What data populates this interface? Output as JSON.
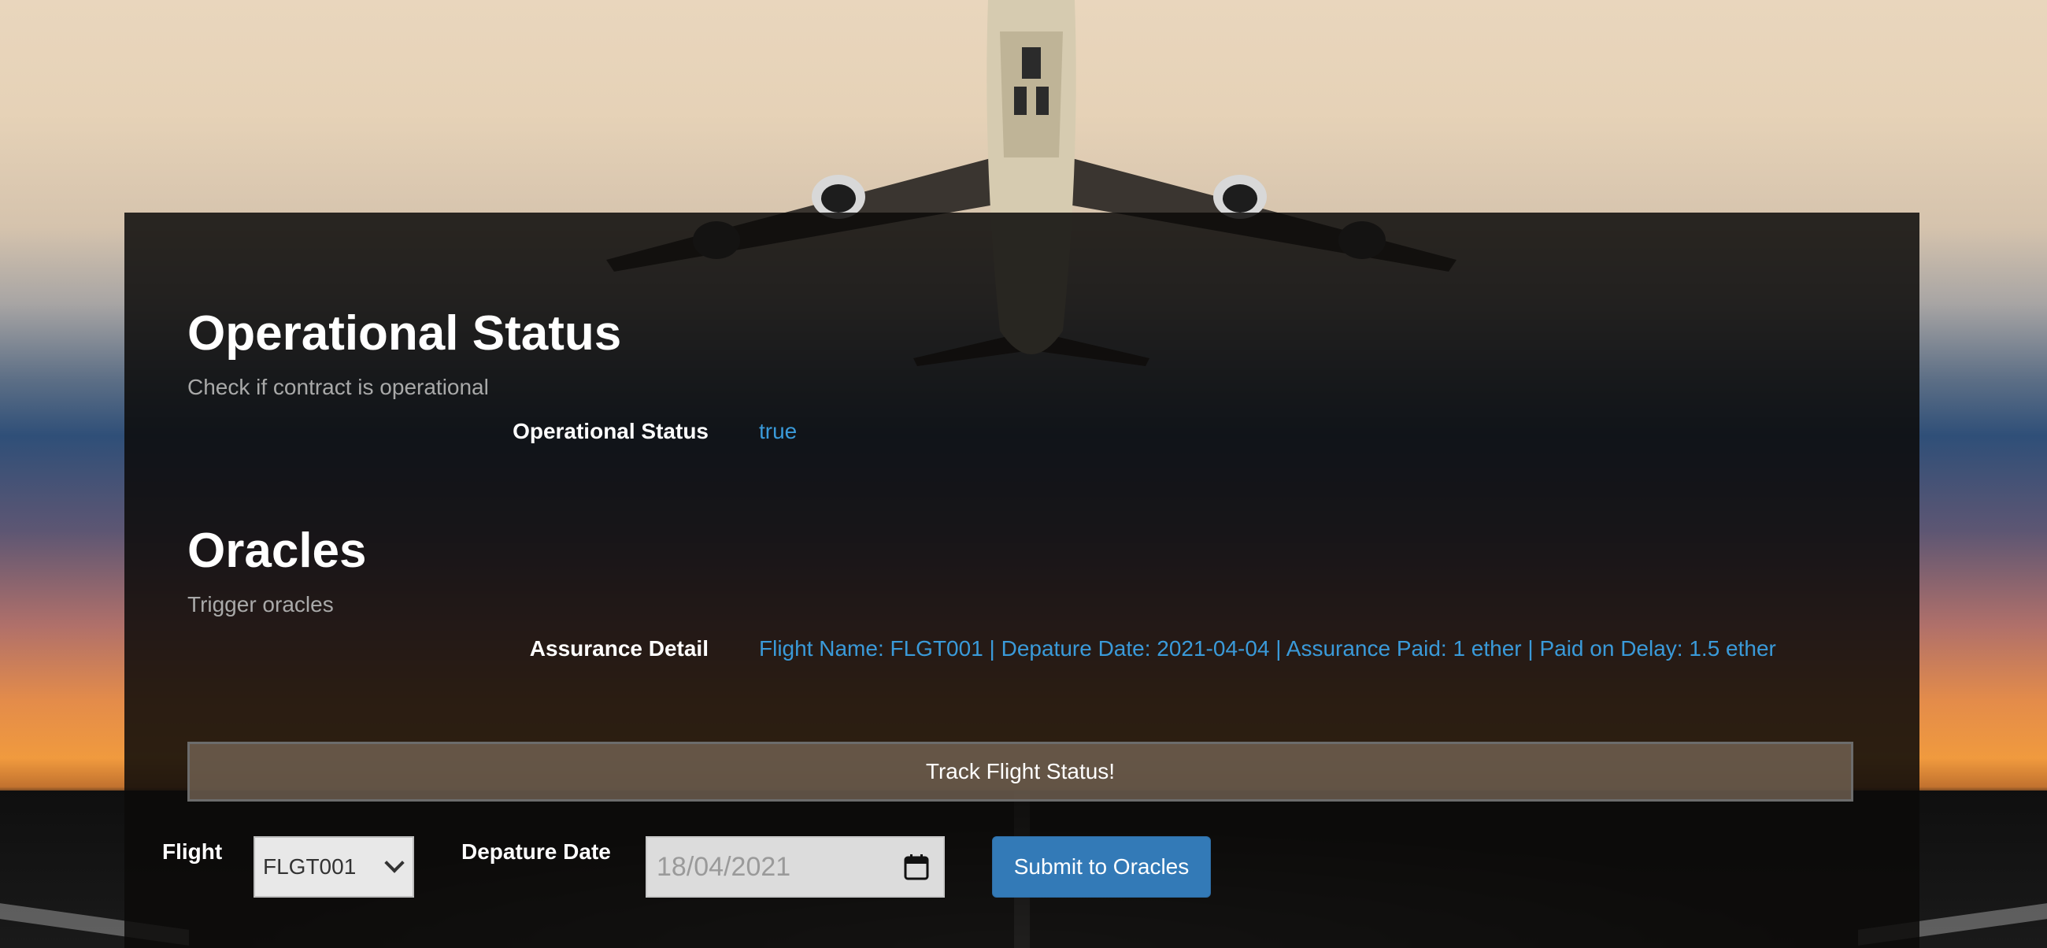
{
  "colors": {
    "panel_bg": "#0c0a09",
    "accent_value": "#3a9ad9",
    "primary_button": "#337ab7"
  },
  "operational": {
    "title": "Operational Status",
    "subtitle": "Check if contract is operational",
    "label": "Operational Status",
    "value": "true"
  },
  "oracles": {
    "title": "Oracles",
    "subtitle": "Trigger oracles",
    "detail_label": "Assurance Detail",
    "detail_value": "Flight Name: FLGT001 | Depature Date: 2021-04-04 | Assurance Paid: 1 ether | Paid on Delay: 1.5 ether",
    "track_button": "Track Flight Status!"
  },
  "form": {
    "flight_label": "Flight",
    "flight_selected": "FLGT001",
    "date_label": "Depature Date",
    "date_value": "18/04/2021",
    "submit_label": "Submit to Oracles"
  },
  "icons": {
    "dropdown": "chevron-down-icon",
    "calendar": "calendar-icon"
  }
}
